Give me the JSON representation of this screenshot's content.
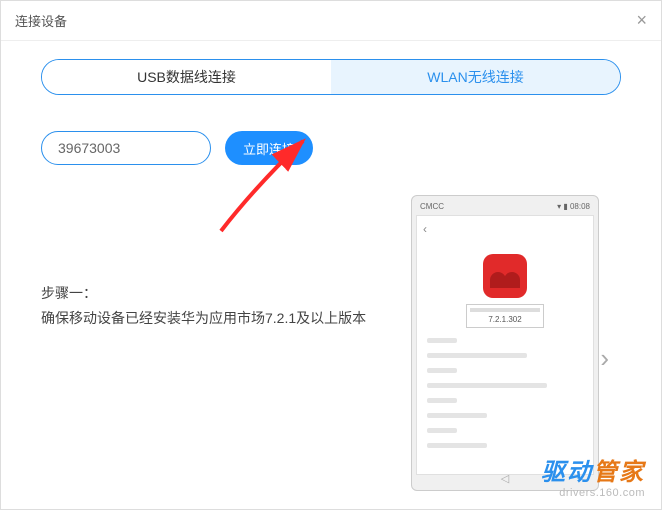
{
  "window": {
    "title": "连接设备"
  },
  "tabs": {
    "usb": "USB数据线连接",
    "wlan": "WLAN无线连接"
  },
  "connect": {
    "code_value": "39673003",
    "button": "立即连接"
  },
  "step": {
    "heading": "步骤一：",
    "desc": "确保移动设备已经安装华为应用市场7.2.1及以上版本"
  },
  "phone": {
    "carrier": "CMCC",
    "time": "08:08",
    "version": "7.2.1.302",
    "wifi_icon": "wifi-icon",
    "battery_icon": "battery-icon",
    "back_glyph": "‹",
    "nav_glyph": "◁"
  },
  "watermark": {
    "brand_p1": "驱动",
    "brand_p2": "管家",
    "url": "drivers.160.com"
  }
}
